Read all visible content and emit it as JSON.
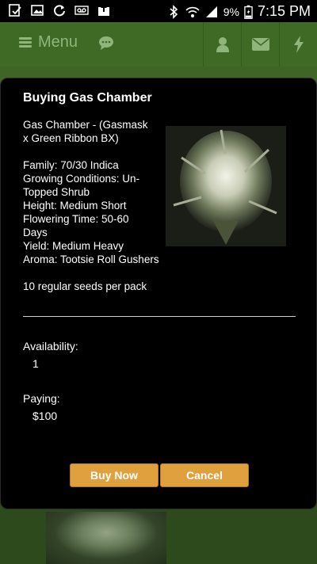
{
  "status_bar": {
    "battery_percent": "9%",
    "time": "7:15 PM"
  },
  "header": {
    "menu_label": "Menu"
  },
  "dialog": {
    "title": "Buying Gas Chamber",
    "description": "Gas Chamber - (Gasmask\nx Green Ribbon BX)\n\nFamily: 70/30 Indica\nGrowing Conditions: Un-\nTopped Shrub\nHeight: Medium Short\nFlowering Time: 50-60\nDays\nYield: Medium Heavy\nAroma: Tootsie Roll Gushers\n\n10 regular seeds per pack",
    "availability_label": "Availability:",
    "availability_value": "1",
    "paying_label": "Paying:",
    "paying_value": "$100",
    "buy_label": "Buy Now",
    "cancel_label": "Cancel"
  }
}
